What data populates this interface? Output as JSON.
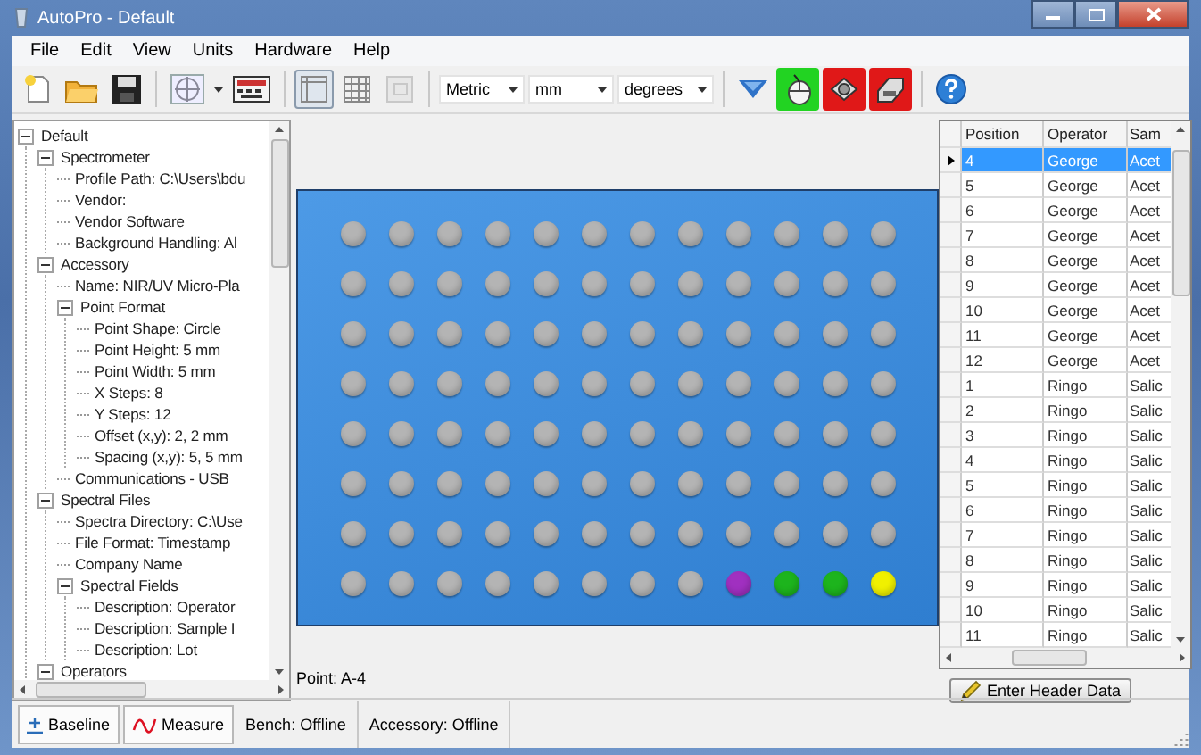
{
  "window": {
    "title": "AutoPro - Default"
  },
  "menu": [
    "File",
    "Edit",
    "View",
    "Units",
    "Hardware",
    "Help"
  ],
  "toolbar": {
    "view_toggles": [
      {
        "kind": "layout",
        "selected": true,
        "disabled": false
      },
      {
        "kind": "grid",
        "selected": false,
        "disabled": false
      },
      {
        "kind": "panel",
        "selected": false,
        "disabled": true
      }
    ],
    "dropdowns": [
      {
        "value": "Metric"
      },
      {
        "value": "mm"
      },
      {
        "value": "degrees"
      }
    ],
    "devices": [
      {
        "kind": "mouse",
        "on": true
      },
      {
        "kind": "disk",
        "on": false
      },
      {
        "kind": "drive",
        "on": false
      }
    ]
  },
  "tree": [
    {
      "label": "Default",
      "expanded": true,
      "children": [
        {
          "label": "Spectrometer",
          "expanded": true,
          "children": [
            {
              "label": "Profile Path: C:\\Users\\bdu"
            },
            {
              "label": "Vendor:"
            },
            {
              "label": "Vendor Software"
            },
            {
              "label": "Background Handling: Al"
            }
          ]
        },
        {
          "label": "Accessory",
          "expanded": true,
          "children": [
            {
              "label": "Name: NIR/UV Micro-Pla"
            },
            {
              "label": "Point Format",
              "expanded": true,
              "children": [
                {
                  "label": "Point Shape: Circle"
                },
                {
                  "label": "Point Height: 5 mm"
                },
                {
                  "label": "Point Width: 5 mm"
                },
                {
                  "label": "X Steps: 8"
                },
                {
                  "label": "Y Steps: 12"
                },
                {
                  "label": "Offset (x,y): 2, 2 mm"
                },
                {
                  "label": "Spacing (x,y): 5, 5 mm"
                }
              ]
            },
            {
              "label": "Communications - USB"
            }
          ]
        },
        {
          "label": "Spectral Files",
          "expanded": true,
          "children": [
            {
              "label": "Spectra Directory: C:\\Use"
            },
            {
              "label": "File Format: Timestamp"
            },
            {
              "label": "Company Name"
            },
            {
              "label": "Spectral Fields",
              "expanded": true,
              "children": [
                {
                  "label": "Description: Operator"
                },
                {
                  "label": "Description: Sample I"
                },
                {
                  "label": "Description: Lot"
                }
              ]
            }
          ]
        },
        {
          "label": "Operators",
          "expanded": true
        }
      ]
    }
  ],
  "plate": {
    "rows": [
      {
        "wells": [
          {
            "color": "#b4b4b4"
          },
          {
            "color": "#b4b4b4"
          },
          {
            "color": "#b4b4b4"
          },
          {
            "color": "#b4b4b4"
          },
          {
            "color": "#b4b4b4"
          },
          {
            "color": "#b4b4b4"
          },
          {
            "color": "#b4b4b4"
          },
          {
            "color": "#b4b4b4"
          },
          {
            "color": "#b4b4b4"
          },
          {
            "color": "#b4b4b4"
          },
          {
            "color": "#b4b4b4"
          },
          {
            "color": "#b4b4b4"
          }
        ]
      },
      {
        "wells": [
          {
            "color": "#b4b4b4"
          },
          {
            "color": "#b4b4b4"
          },
          {
            "color": "#b4b4b4"
          },
          {
            "color": "#b4b4b4"
          },
          {
            "color": "#b4b4b4"
          },
          {
            "color": "#b4b4b4"
          },
          {
            "color": "#b4b4b4"
          },
          {
            "color": "#b4b4b4"
          },
          {
            "color": "#b4b4b4"
          },
          {
            "color": "#b4b4b4"
          },
          {
            "color": "#b4b4b4"
          },
          {
            "color": "#b4b4b4"
          }
        ]
      },
      {
        "wells": [
          {
            "color": "#b4b4b4"
          },
          {
            "color": "#b4b4b4"
          },
          {
            "color": "#b4b4b4"
          },
          {
            "color": "#b4b4b4"
          },
          {
            "color": "#b4b4b4"
          },
          {
            "color": "#b4b4b4"
          },
          {
            "color": "#b4b4b4"
          },
          {
            "color": "#b4b4b4"
          },
          {
            "color": "#b4b4b4"
          },
          {
            "color": "#b4b4b4"
          },
          {
            "color": "#b4b4b4"
          },
          {
            "color": "#b4b4b4"
          }
        ]
      },
      {
        "wells": [
          {
            "color": "#b4b4b4"
          },
          {
            "color": "#b4b4b4"
          },
          {
            "color": "#b4b4b4"
          },
          {
            "color": "#b4b4b4"
          },
          {
            "color": "#b4b4b4"
          },
          {
            "color": "#b4b4b4"
          },
          {
            "color": "#b4b4b4"
          },
          {
            "color": "#b4b4b4"
          },
          {
            "color": "#b4b4b4"
          },
          {
            "color": "#b4b4b4"
          },
          {
            "color": "#b4b4b4"
          },
          {
            "color": "#b4b4b4"
          }
        ]
      },
      {
        "wells": [
          {
            "color": "#b4b4b4"
          },
          {
            "color": "#b4b4b4"
          },
          {
            "color": "#b4b4b4"
          },
          {
            "color": "#b4b4b4"
          },
          {
            "color": "#b4b4b4"
          },
          {
            "color": "#b4b4b4"
          },
          {
            "color": "#b4b4b4"
          },
          {
            "color": "#b4b4b4"
          },
          {
            "color": "#b4b4b4"
          },
          {
            "color": "#b4b4b4"
          },
          {
            "color": "#b4b4b4"
          },
          {
            "color": "#b4b4b4"
          }
        ]
      },
      {
        "wells": [
          {
            "color": "#b4b4b4"
          },
          {
            "color": "#b4b4b4"
          },
          {
            "color": "#b4b4b4"
          },
          {
            "color": "#b4b4b4"
          },
          {
            "color": "#b4b4b4"
          },
          {
            "color": "#b4b4b4"
          },
          {
            "color": "#b4b4b4"
          },
          {
            "color": "#b4b4b4"
          },
          {
            "color": "#b4b4b4"
          },
          {
            "color": "#b4b4b4"
          },
          {
            "color": "#b4b4b4"
          },
          {
            "color": "#b4b4b4"
          }
        ]
      },
      {
        "wells": [
          {
            "color": "#b4b4b4"
          },
          {
            "color": "#b4b4b4"
          },
          {
            "color": "#b4b4b4"
          },
          {
            "color": "#b4b4b4"
          },
          {
            "color": "#b4b4b4"
          },
          {
            "color": "#b4b4b4"
          },
          {
            "color": "#b4b4b4"
          },
          {
            "color": "#b4b4b4"
          },
          {
            "color": "#b4b4b4"
          },
          {
            "color": "#b4b4b4"
          },
          {
            "color": "#b4b4b4"
          },
          {
            "color": "#b4b4b4"
          }
        ]
      },
      {
        "wells": [
          {
            "color": "#b4b4b4"
          },
          {
            "color": "#b4b4b4"
          },
          {
            "color": "#b4b4b4"
          },
          {
            "color": "#b4b4b4"
          },
          {
            "color": "#b4b4b4"
          },
          {
            "color": "#b4b4b4"
          },
          {
            "color": "#b4b4b4"
          },
          {
            "color": "#b4b4b4"
          },
          {
            "color": "#a030c0"
          },
          {
            "color": "#1db41d"
          },
          {
            "color": "#1db41d"
          },
          {
            "color": "#f0f000"
          }
        ]
      }
    ]
  },
  "point_label": "Point: A-4",
  "grid": {
    "columns": [
      "Position",
      "Operator",
      "Sam"
    ],
    "rows": [
      {
        "cells": [
          "4",
          "George",
          "Acet"
        ],
        "selected": true
      },
      {
        "cells": [
          "5",
          "George",
          "Acet"
        ],
        "selected": false
      },
      {
        "cells": [
          "6",
          "George",
          "Acet"
        ],
        "selected": false
      },
      {
        "cells": [
          "7",
          "George",
          "Acet"
        ],
        "selected": false
      },
      {
        "cells": [
          "8",
          "George",
          "Acet"
        ],
        "selected": false
      },
      {
        "cells": [
          "9",
          "George",
          "Acet"
        ],
        "selected": false
      },
      {
        "cells": [
          "10",
          "George",
          "Acet"
        ],
        "selected": false
      },
      {
        "cells": [
          "11",
          "George",
          "Acet"
        ],
        "selected": false
      },
      {
        "cells": [
          "12",
          "George",
          "Acet"
        ],
        "selected": false
      },
      {
        "cells": [
          "1",
          "Ringo",
          "Salic"
        ],
        "selected": false
      },
      {
        "cells": [
          "2",
          "Ringo",
          "Salic"
        ],
        "selected": false
      },
      {
        "cells": [
          "3",
          "Ringo",
          "Salic"
        ],
        "selected": false
      },
      {
        "cells": [
          "4",
          "Ringo",
          "Salic"
        ],
        "selected": false
      },
      {
        "cells": [
          "5",
          "Ringo",
          "Salic"
        ],
        "selected": false
      },
      {
        "cells": [
          "6",
          "Ringo",
          "Salic"
        ],
        "selected": false
      },
      {
        "cells": [
          "7",
          "Ringo",
          "Salic"
        ],
        "selected": false
      },
      {
        "cells": [
          "8",
          "Ringo",
          "Salic"
        ],
        "selected": false
      },
      {
        "cells": [
          "9",
          "Ringo",
          "Salic"
        ],
        "selected": false
      },
      {
        "cells": [
          "10",
          "Ringo",
          "Salic"
        ],
        "selected": false
      },
      {
        "cells": [
          "11",
          "Ringo",
          "Salic"
        ],
        "selected": false
      }
    ]
  },
  "header_button": "Enter Header Data",
  "status_bar": {
    "buttons": [
      {
        "kind": "baseline",
        "label": "Baseline"
      },
      {
        "kind": "measure",
        "label": "Measure"
      }
    ],
    "fields": [
      "Bench: Offline",
      "Accessory: Offline"
    ]
  }
}
